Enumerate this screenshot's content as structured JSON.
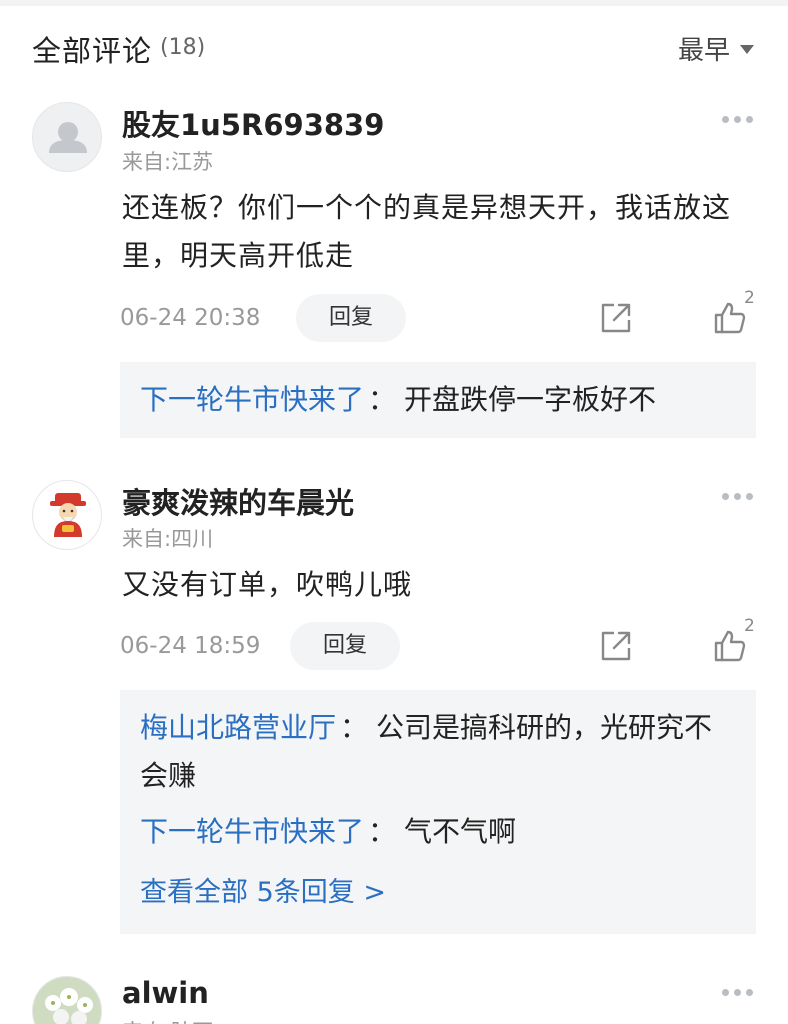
{
  "header": {
    "title": "全部评论",
    "count": "(18)",
    "sort_label": "最早"
  },
  "comments": [
    {
      "username": "股友1u5R693839",
      "location": "来自:江苏",
      "content": "还连板？你们一个个的真是异想天开，我话放这里，明天高开低走",
      "time": "06-24 20:38",
      "reply_label": "回复",
      "likes": "2",
      "avatar_icon": "default-user-icon",
      "replies": [
        {
          "user": "下一轮牛市快来了",
          "colon": "：",
          "text": "开盘跌停一字板好不"
        }
      ]
    },
    {
      "username": "豪爽泼辣的车晨光",
      "location": "来自:四川",
      "content": "又没有订单，吹鸭儿哦",
      "time": "06-24 18:59",
      "reply_label": "回复",
      "likes": "2",
      "avatar_icon": "fortune-god-icon",
      "replies": [
        {
          "user": "梅山北路营业厅",
          "colon": "：",
          "text": "公司是搞科研的，光研究不会赚"
        },
        {
          "user": "下一轮牛市快来了",
          "colon": "：",
          "text": "气不气啊"
        }
      ],
      "view_all": "查看全部 5条回复 >"
    },
    {
      "username": "alwin",
      "location": "来自:陕西",
      "avatar_icon": "flower-photo-icon"
    }
  ],
  "colors": {
    "link_blue": "#2b6fc2",
    "reply_bg": "#f4f5f7",
    "muted_gray": "#999999"
  }
}
